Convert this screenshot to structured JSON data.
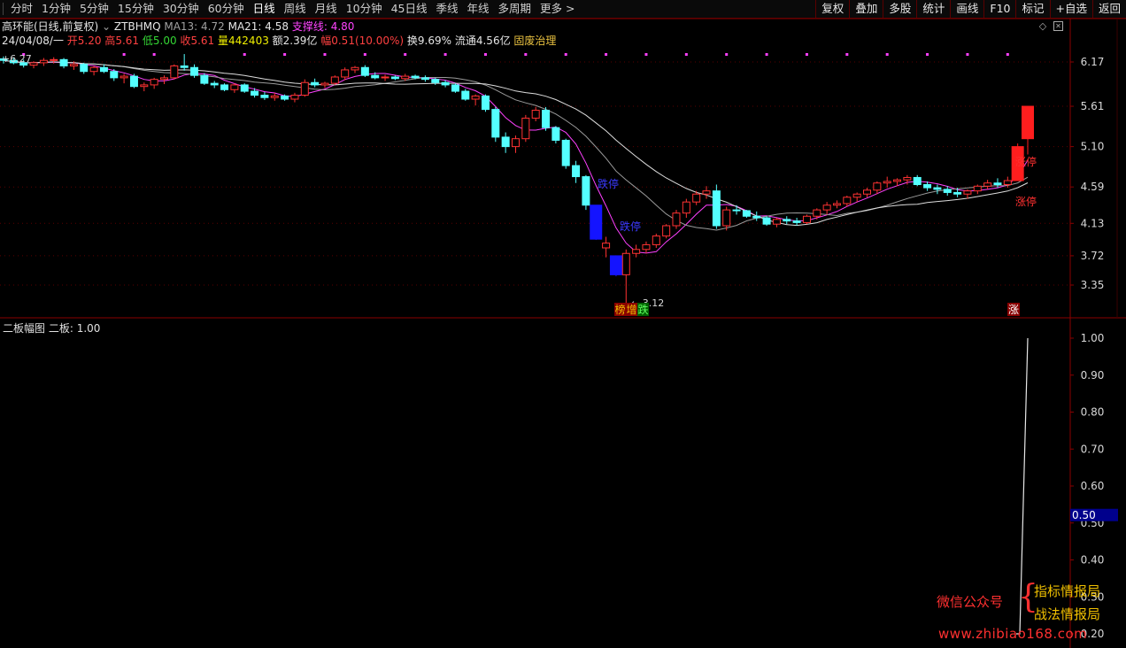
{
  "toolbar": {
    "timeframes": [
      "分时",
      "1分钟",
      "5分钟",
      "15分钟",
      "30分钟",
      "60分钟",
      "日线",
      "周线",
      "月线",
      "10分钟",
      "45日线",
      "季线",
      "年线",
      "多周期",
      "更多 >"
    ],
    "active_index": 6,
    "right_buttons": [
      "复权",
      "叠加",
      "多股",
      "统计",
      "画线",
      "F10",
      "标记",
      "+自选",
      "返回"
    ]
  },
  "header": {
    "name": "高环能(日线,前复权)",
    "indicator": "ZTBHMQ",
    "ma13_label": "MA13: 4.72",
    "ma21_label": "MA21: 4.58",
    "support_label": "支撑线: 4.80",
    "date": "24/04/08/一",
    "open_label": "开5.20",
    "high_label": "高5.61",
    "low_label": "低5.00",
    "close_label": "收5.61",
    "volume_label": "量442403",
    "amount_label": "额2.39亿",
    "change_label": "幅0.51(10.00%)",
    "turnover_label": "换9.69%",
    "float_label": "流通4.56亿",
    "tag_label": "固废治理"
  },
  "main_axis": {
    "labels": [
      "6.17",
      "5.61",
      "5.10",
      "4.59",
      "4.13",
      "3.72",
      "3.35"
    ],
    "values": [
      6.17,
      5.61,
      5.1,
      4.59,
      4.13,
      3.72,
      3.35
    ],
    "min": 3.0,
    "max": 6.5
  },
  "annotations": {
    "high_mark": "6.27",
    "low_mark": "← 3.12",
    "limit_down": "跌停",
    "limit_up": "涨停",
    "badge_bang": "榜",
    "badge_zeng": "增",
    "badge_die": "跌",
    "badge_zhang": "涨"
  },
  "sub_chart": {
    "title": "二板幅图",
    "value_label": "二板: 1.00",
    "axis_labels": [
      "1.00",
      "0.90",
      "0.80",
      "0.70",
      "0.60",
      "0.50",
      "0.40",
      "0.30",
      "0.20"
    ],
    "axis_values": [
      1.0,
      0.9,
      0.8,
      0.7,
      0.6,
      0.5,
      0.4,
      0.3,
      0.2
    ],
    "highlight_label": "0.50",
    "line_values": [
      0.2,
      0.2,
      1.0
    ]
  },
  "watermark": {
    "left": "微信公众号",
    "right1": "指标情报局",
    "right2": "战法情报局",
    "url": "www.zhibiao168.com"
  },
  "colors": {
    "up": "#ff3232",
    "down": "#54ffff",
    "limit_up": "#ff1e1e",
    "limit_down": "#1414ff",
    "ma_white": "#dcdcdc",
    "ma_gray": "#9a9a9a",
    "ma_mag": "#ff40ff",
    "dots": "#ff40ff",
    "frame": "#8a0000"
  },
  "chart_data": {
    "type": "candlestick",
    "candles": [
      [
        6.21,
        6.24,
        6.15,
        6.19
      ],
      [
        6.19,
        6.22,
        6.14,
        6.16
      ],
      [
        6.16,
        6.2,
        6.1,
        6.13
      ],
      [
        6.13,
        6.18,
        6.09,
        6.16
      ],
      [
        6.16,
        6.22,
        6.12,
        6.19
      ],
      [
        6.19,
        6.23,
        6.15,
        6.2
      ],
      [
        6.2,
        6.22,
        6.09,
        6.12
      ],
      [
        6.12,
        6.18,
        6.07,
        6.14
      ],
      [
        6.14,
        6.16,
        6.02,
        6.05
      ],
      [
        6.05,
        6.12,
        6.0,
        6.1
      ],
      [
        6.1,
        6.14,
        6.03,
        6.05
      ],
      [
        6.05,
        6.08,
        5.93,
        5.97
      ],
      [
        5.97,
        6.02,
        5.9,
        5.99
      ],
      [
        5.99,
        6.02,
        5.84,
        5.86
      ],
      [
        5.86,
        5.91,
        5.8,
        5.88
      ],
      [
        5.88,
        5.97,
        5.83,
        5.95
      ],
      [
        5.95,
        6.0,
        5.89,
        5.97
      ],
      [
        5.97,
        6.14,
        5.95,
        6.12
      ],
      [
        6.12,
        6.27,
        6.06,
        6.1
      ],
      [
        6.1,
        6.14,
        5.97,
        6.0
      ],
      [
        6.0,
        6.03,
        5.88,
        5.9
      ],
      [
        5.9,
        5.93,
        5.84,
        5.88
      ],
      [
        5.88,
        5.9,
        5.8,
        5.82
      ],
      [
        5.82,
        5.9,
        5.78,
        5.88
      ],
      [
        5.88,
        5.9,
        5.78,
        5.8
      ],
      [
        5.8,
        5.84,
        5.72,
        5.75
      ],
      [
        5.75,
        5.79,
        5.69,
        5.72
      ],
      [
        5.72,
        5.78,
        5.68,
        5.74
      ],
      [
        5.74,
        5.76,
        5.68,
        5.7
      ],
      [
        5.7,
        5.78,
        5.66,
        5.75
      ],
      [
        5.75,
        5.95,
        5.73,
        5.91
      ],
      [
        5.91,
        5.96,
        5.85,
        5.88
      ],
      [
        5.88,
        5.92,
        5.84,
        5.9
      ],
      [
        5.9,
        6.0,
        5.88,
        5.98
      ],
      [
        5.98,
        6.1,
        5.94,
        6.07
      ],
      [
        6.07,
        6.12,
        6.03,
        6.1
      ],
      [
        6.1,
        6.13,
        5.98,
        6.0
      ],
      [
        6.0,
        6.04,
        5.95,
        5.97
      ],
      [
        5.97,
        6.01,
        5.93,
        5.98
      ],
      [
        5.98,
        6.0,
        5.94,
        5.96
      ],
      [
        5.96,
        6.02,
        5.93,
        5.99
      ],
      [
        5.99,
        6.01,
        5.95,
        5.97
      ],
      [
        5.97,
        6.0,
        5.92,
        5.95
      ],
      [
        5.95,
        5.97,
        5.88,
        5.91
      ],
      [
        5.91,
        5.94,
        5.85,
        5.88
      ],
      [
        5.88,
        5.9,
        5.78,
        5.8
      ],
      [
        5.8,
        5.83,
        5.68,
        5.7
      ],
      [
        5.7,
        5.76,
        5.62,
        5.74
      ],
      [
        5.74,
        5.76,
        5.54,
        5.57
      ],
      [
        5.57,
        5.6,
        5.16,
        5.22
      ],
      [
        5.22,
        5.28,
        5.02,
        5.1
      ],
      [
        5.1,
        5.24,
        5.02,
        5.2
      ],
      [
        5.2,
        5.5,
        5.16,
        5.46
      ],
      [
        5.46,
        5.6,
        5.42,
        5.56
      ],
      [
        5.56,
        5.6,
        5.3,
        5.34
      ],
      [
        5.34,
        5.36,
        5.14,
        5.18
      ],
      [
        5.18,
        5.2,
        4.82,
        4.86
      ],
      [
        4.86,
        4.92,
        4.64,
        4.72
      ],
      [
        4.72,
        4.74,
        4.3,
        4.36
      ],
      [
        4.36,
        4.36,
        3.92,
        3.93
      ],
      [
        3.82,
        3.96,
        3.7,
        3.88
      ],
      [
        3.72,
        3.72,
        3.46,
        3.48
      ],
      [
        3.48,
        3.8,
        3.12,
        3.75
      ],
      [
        3.75,
        3.86,
        3.7,
        3.8
      ],
      [
        3.8,
        3.9,
        3.75,
        3.86
      ],
      [
        3.86,
        4.0,
        3.82,
        3.97
      ],
      [
        3.97,
        4.12,
        3.94,
        4.1
      ],
      [
        4.1,
        4.3,
        4.06,
        4.26
      ],
      [
        4.26,
        4.44,
        4.2,
        4.4
      ],
      [
        4.4,
        4.54,
        4.36,
        4.5
      ],
      [
        4.5,
        4.6,
        4.44,
        4.54
      ],
      [
        4.54,
        4.62,
        4.06,
        4.1
      ],
      [
        4.1,
        4.34,
        4.04,
        4.3
      ],
      [
        4.3,
        4.36,
        4.24,
        4.29
      ],
      [
        4.29,
        4.3,
        4.2,
        4.22
      ],
      [
        4.22,
        4.28,
        4.16,
        4.2
      ],
      [
        4.2,
        4.22,
        4.1,
        4.12
      ],
      [
        4.12,
        4.2,
        4.08,
        4.18
      ],
      [
        4.18,
        4.22,
        4.12,
        4.16
      ],
      [
        4.16,
        4.2,
        4.1,
        4.14
      ],
      [
        4.14,
        4.24,
        4.12,
        4.22
      ],
      [
        4.22,
        4.32,
        4.18,
        4.3
      ],
      [
        4.3,
        4.4,
        4.24,
        4.36
      ],
      [
        4.36,
        4.42,
        4.32,
        4.38
      ],
      [
        4.38,
        4.48,
        4.34,
        4.46
      ],
      [
        4.46,
        4.52,
        4.4,
        4.5
      ],
      [
        4.5,
        4.58,
        4.46,
        4.55
      ],
      [
        4.55,
        4.66,
        4.5,
        4.64
      ],
      [
        4.64,
        4.72,
        4.58,
        4.66
      ],
      [
        4.66,
        4.7,
        4.6,
        4.68
      ],
      [
        4.68,
        4.74,
        4.62,
        4.71
      ],
      [
        4.71,
        4.74,
        4.6,
        4.62
      ],
      [
        4.62,
        4.66,
        4.54,
        4.58
      ],
      [
        4.58,
        4.62,
        4.5,
        4.56
      ],
      [
        4.56,
        4.6,
        4.48,
        4.52
      ],
      [
        4.52,
        4.58,
        4.46,
        4.5
      ],
      [
        4.5,
        4.56,
        4.44,
        4.54
      ],
      [
        4.54,
        4.62,
        4.5,
        4.6
      ],
      [
        4.6,
        4.68,
        4.56,
        4.64
      ],
      [
        4.64,
        4.7,
        4.58,
        4.62
      ],
      [
        4.62,
        4.72,
        4.58,
        4.67
      ],
      [
        4.67,
        5.14,
        4.67,
        5.1
      ],
      [
        5.2,
        5.61,
        5.0,
        5.61
      ]
    ],
    "limit_up_index": [
      101,
      102
    ],
    "limit_down_index": [
      59,
      61
    ]
  }
}
